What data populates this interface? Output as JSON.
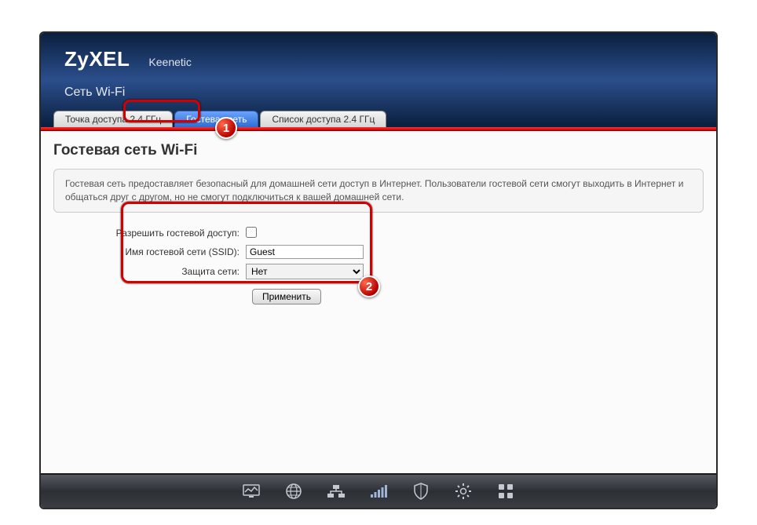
{
  "brand": "ZyXEL",
  "model": "Keenetic",
  "page_title": "Сеть Wi-Fi",
  "tabs": [
    {
      "label": "Точка доступа 2.4 ГГц",
      "active": false
    },
    {
      "label": "Гостевая сеть",
      "active": true
    },
    {
      "label": "Список доступа 2.4 ГГц",
      "active": false
    }
  ],
  "section_title": "Гостевая сеть Wi-Fi",
  "info_text": "Гостевая сеть предоставляет безопасный для домашней сети доступ в Интернет. Пользователи гостевой сети смогут выходить в Интернет и общаться друг с другом, но не смогут подключиться к вашей домашней сети.",
  "form": {
    "allow_label": "Разрешить гостевой доступ:",
    "allow_checked": false,
    "ssid_label": "Имя гостевой сети (SSID):",
    "ssid_value": "Guest",
    "security_label": "Защита сети:",
    "security_value": "Нет",
    "apply_label": "Применить"
  },
  "callouts": {
    "one": "1",
    "two": "2"
  },
  "nav_icons": [
    "monitor",
    "globe",
    "network",
    "wifi",
    "shield",
    "gear",
    "apps"
  ]
}
